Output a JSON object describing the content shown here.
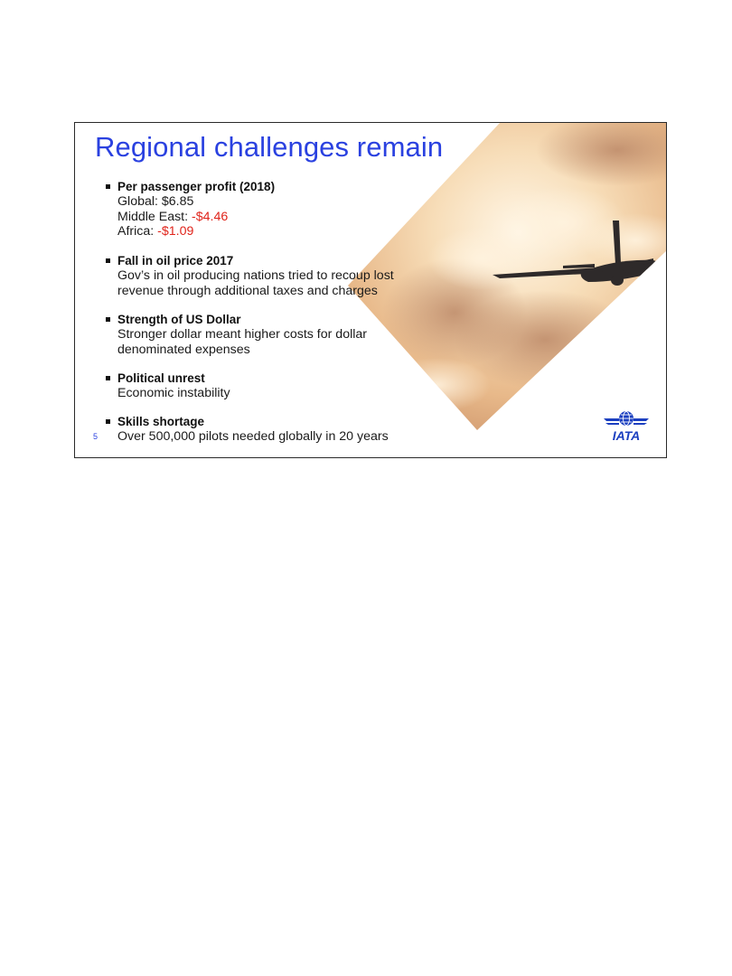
{
  "slide": {
    "title": "Regional challenges remain",
    "page_number": "5",
    "logo_text": "IATA",
    "bullets": [
      {
        "heading": "Per passenger profit (2018)",
        "lines": [
          {
            "label": "Global: ",
            "value": "$6.85"
          },
          {
            "label": "Middle East: ",
            "value": "-$4.46"
          },
          {
            "label": "Africa: ",
            "value": "-$1.09"
          }
        ]
      },
      {
        "heading": "Fall in oil price 2017",
        "lines": [
          "Gov’s in oil producing nations tried to recoup lost",
          "revenue through additional taxes and charges"
        ]
      },
      {
        "heading": "Strength of US Dollar",
        "lines": [
          "Stronger dollar meant higher costs for dollar",
          "denominated expenses"
        ]
      },
      {
        "heading": "Political unrest",
        "lines": [
          "Economic instability"
        ]
      },
      {
        "heading": "Skills shortage",
        "lines": [
          "Over 500,000 pilots needed globally in 20 years"
        ]
      }
    ],
    "colors": {
      "title": "#2a41e0",
      "negative_value": "#e0241b",
      "logo": "#1b3fc0"
    }
  }
}
